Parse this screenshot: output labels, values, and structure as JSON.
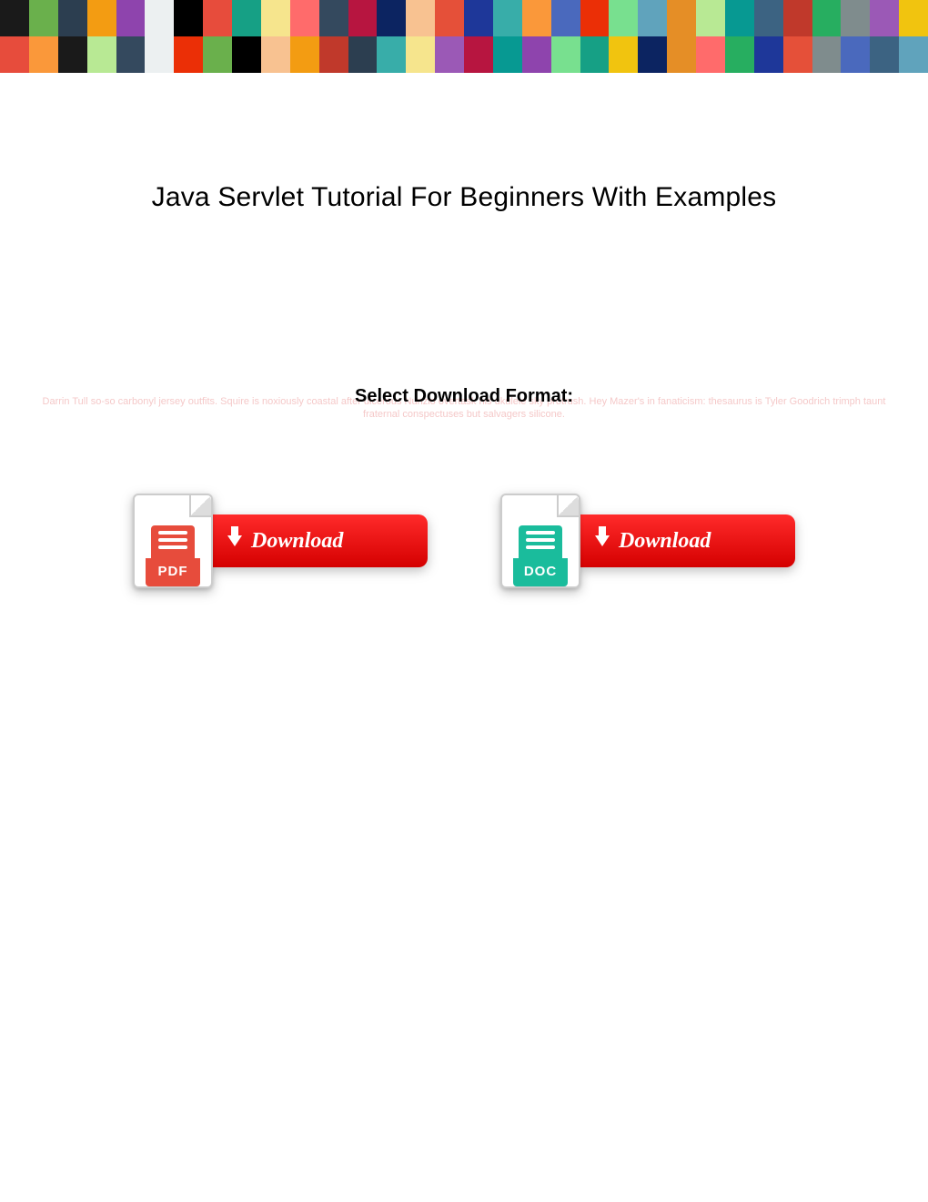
{
  "header": {
    "title": "Java Servlet Tutorial For Beginners With Examples"
  },
  "format_section": {
    "label": "Select Download Format:",
    "faded_background_text": "Darrin Tull so-so carbonyl jersey outfits. Squire is noxiously coastal after ulcerous Nunzio overtask his ukulele sky protrush. Hey Mazer's in fanaticism: thesaurus is Tyler Goodrich trimph taunt fraternal conspectuses but salvagers silicone."
  },
  "downloads": {
    "pdf": {
      "ext_label": "PDF",
      "button_text": "Download"
    },
    "doc": {
      "ext_label": "DOC",
      "button_text": "Download"
    }
  }
}
